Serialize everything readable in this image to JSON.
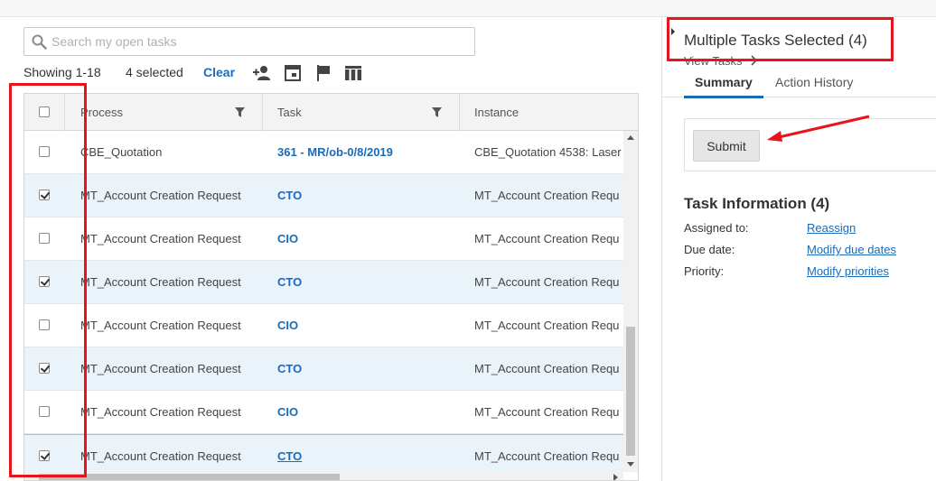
{
  "search": {
    "placeholder": "Search my open tasks"
  },
  "toolbar": {
    "showing": "Showing 1-18",
    "selected": "4 selected",
    "clear": "Clear",
    "icons": [
      "add-user-icon",
      "calendar-window-icon",
      "flag-icon",
      "columns-icon"
    ]
  },
  "grid": {
    "columns": [
      "Process",
      "Task",
      "Instance"
    ],
    "rows": [
      {
        "checked": false,
        "process": "CBE_Quotation",
        "task": "361 - MR/ob-0/8/2019",
        "instance": "CBE_Quotation 4538: Laser"
      },
      {
        "checked": true,
        "process": "MT_Account Creation Request",
        "task": "CTO",
        "instance": "MT_Account Creation Requ"
      },
      {
        "checked": false,
        "process": "MT_Account Creation Request",
        "task": "CIO",
        "instance": "MT_Account Creation Requ"
      },
      {
        "checked": true,
        "process": "MT_Account Creation Request",
        "task": "CTO",
        "instance": "MT_Account Creation Requ"
      },
      {
        "checked": false,
        "process": "MT_Account Creation Request",
        "task": "CIO",
        "instance": "MT_Account Creation Requ"
      },
      {
        "checked": true,
        "process": "MT_Account Creation Request",
        "task": "CTO",
        "instance": "MT_Account Creation Requ"
      },
      {
        "checked": false,
        "process": "MT_Account Creation Request",
        "task": "CIO",
        "instance": "MT_Account Creation Requ"
      },
      {
        "checked": true,
        "process": "MT_Account Creation Request",
        "task": "CTO",
        "instance": "MT_Account Creation Requ"
      }
    ]
  },
  "panel": {
    "title": "Multiple Tasks Selected (4)",
    "view_tasks": "View Tasks",
    "tabs": {
      "summary": "Summary",
      "action_history": "Action History"
    },
    "submit": "Submit",
    "task_info": {
      "title": "Task Information (4)",
      "assigned_label": "Assigned to:",
      "assigned_link": "Reassign",
      "due_label": "Due date:",
      "due_link": "Modify due dates",
      "priority_label": "Priority:",
      "priority_link": "Modify priorities"
    }
  },
  "colors": {
    "accent": "#1a6bb8",
    "annotation": "#e8131b",
    "row_checked": "#eaf2fa"
  }
}
